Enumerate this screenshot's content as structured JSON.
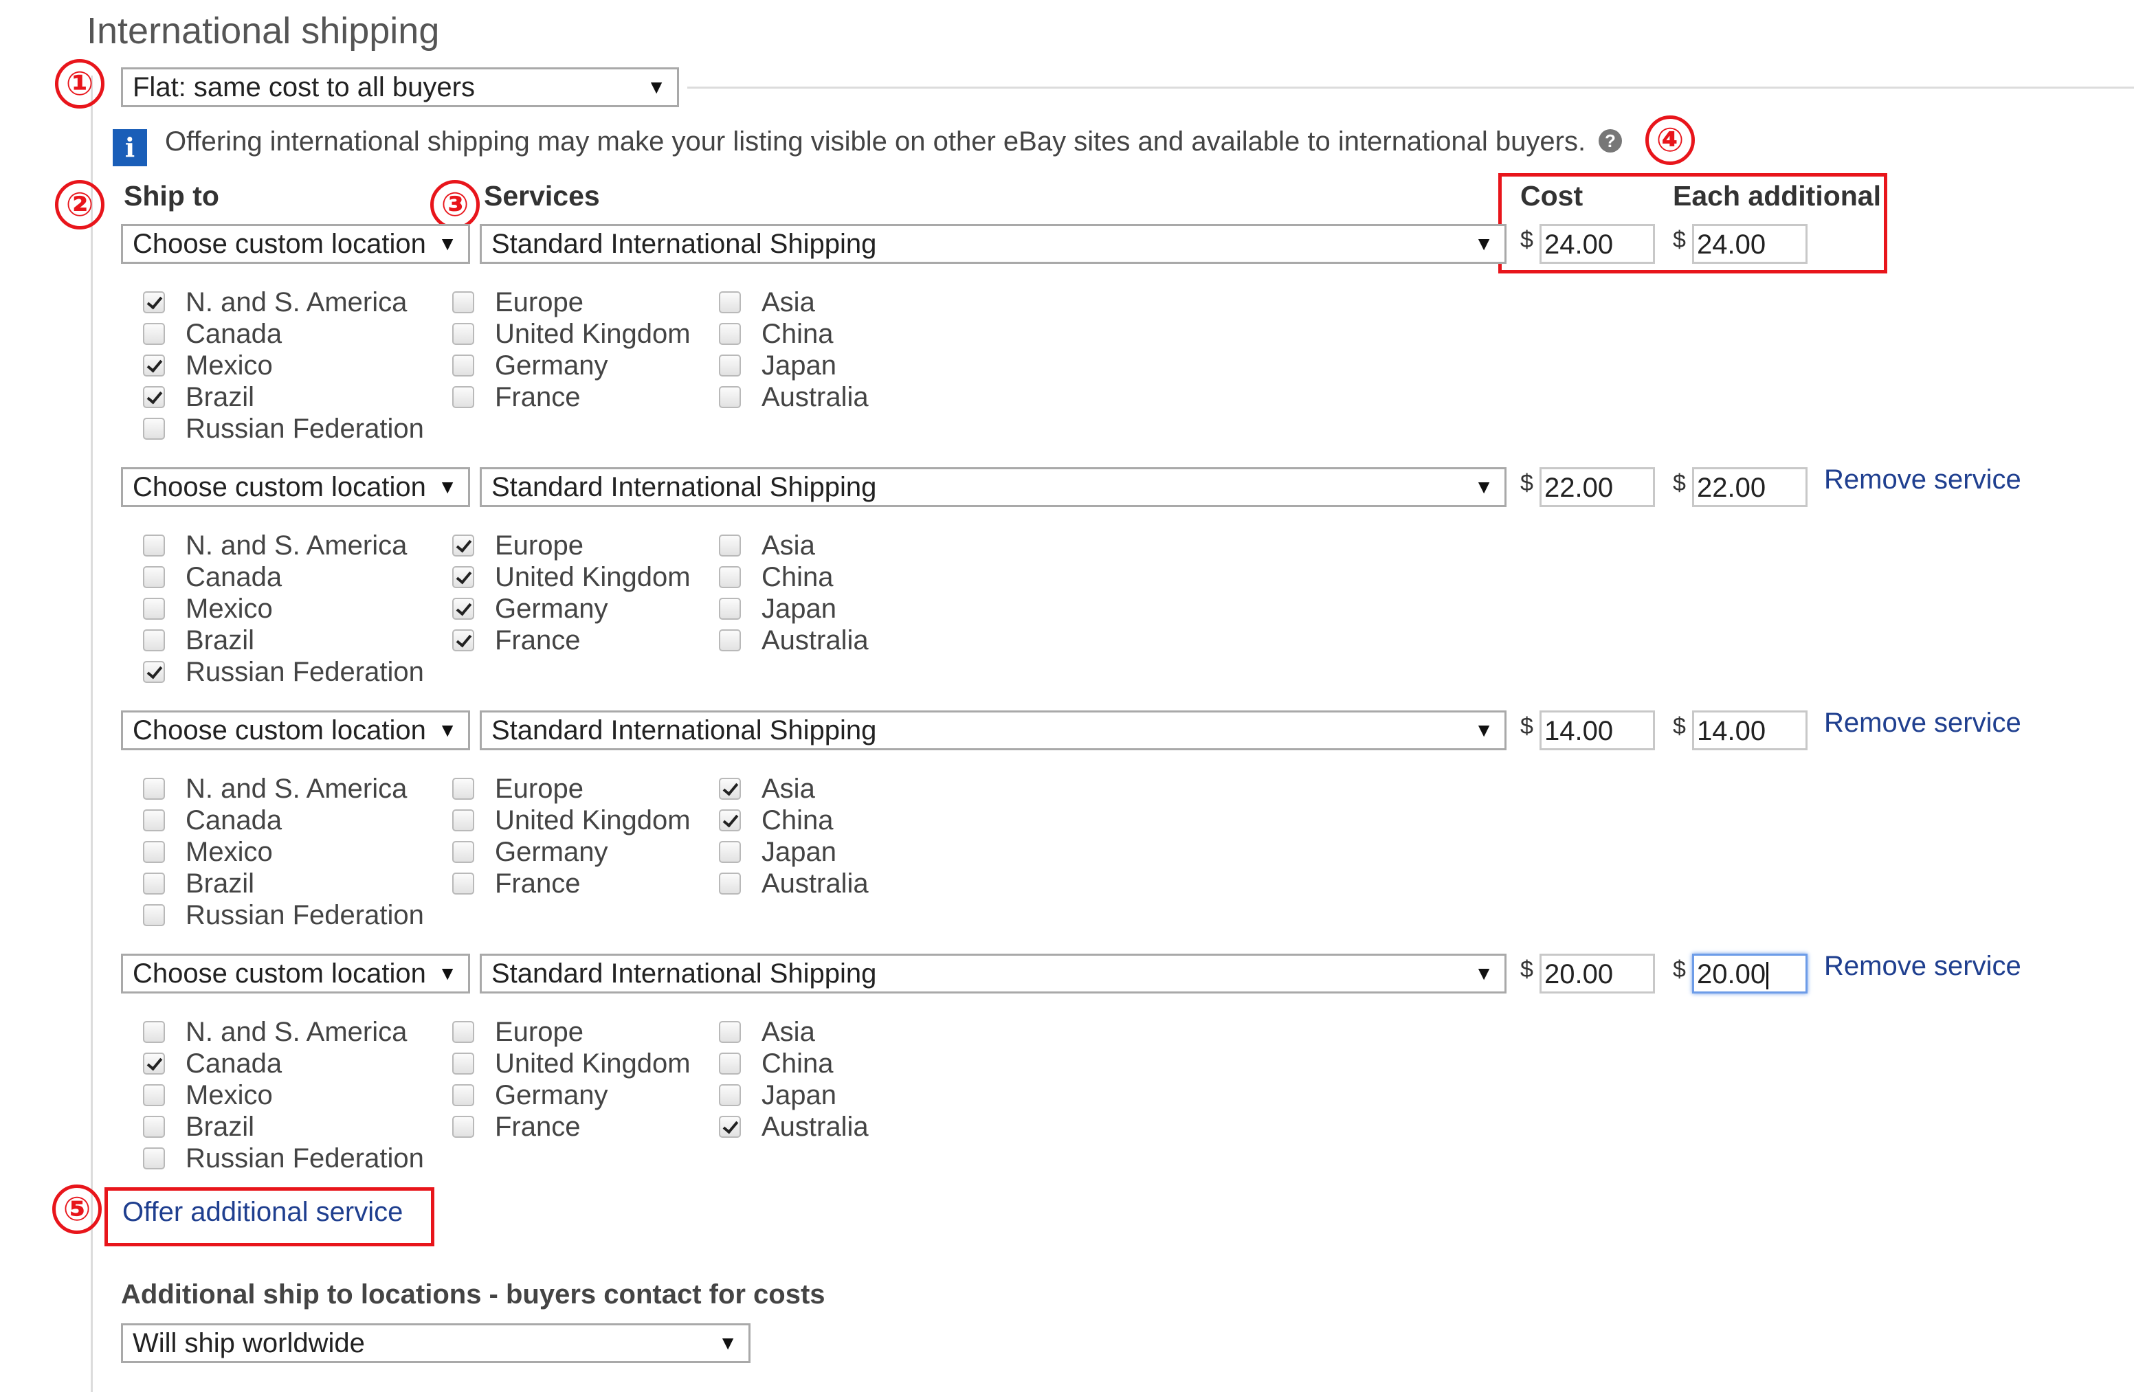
{
  "title": "International shipping",
  "shipping_type": "Flat: same cost to all buyers",
  "info_text": "Offering international shipping may make your listing visible on other eBay sites and available to international buyers.",
  "headers": {
    "ship_to": "Ship to",
    "services": "Services",
    "cost": "Cost",
    "each_additional": "Each additional"
  },
  "badges": [
    "①",
    "②",
    "③",
    "④",
    "⑤"
  ],
  "currency_symbol": "$",
  "services": [
    {
      "ship_to": "Choose custom location",
      "service": "Standard International Shipping",
      "cost": "24.00",
      "each_additional": "24.00",
      "remove_label": "",
      "locations": [
        {
          "label": "N. and S. America",
          "checked": true
        },
        {
          "label": "Canada",
          "checked": false
        },
        {
          "label": "Mexico",
          "checked": true
        },
        {
          "label": "Brazil",
          "checked": true
        },
        {
          "label": "Russian Federation",
          "checked": false
        },
        {
          "label": "Europe",
          "checked": false
        },
        {
          "label": "United Kingdom",
          "checked": false
        },
        {
          "label": "Germany",
          "checked": false
        },
        {
          "label": "France",
          "checked": false
        },
        {
          "label": "Asia",
          "checked": false
        },
        {
          "label": "China",
          "checked": false
        },
        {
          "label": "Japan",
          "checked": false
        },
        {
          "label": "Australia",
          "checked": false
        }
      ]
    },
    {
      "ship_to": "Choose custom location",
      "service": "Standard International Shipping",
      "cost": "22.00",
      "each_additional": "22.00",
      "remove_label": "Remove service",
      "locations": [
        {
          "label": "N. and S. America",
          "checked": false
        },
        {
          "label": "Canada",
          "checked": false
        },
        {
          "label": "Mexico",
          "checked": false
        },
        {
          "label": "Brazil",
          "checked": false
        },
        {
          "label": "Russian Federation",
          "checked": true
        },
        {
          "label": "Europe",
          "checked": true
        },
        {
          "label": "United Kingdom",
          "checked": true
        },
        {
          "label": "Germany",
          "checked": true
        },
        {
          "label": "France",
          "checked": true
        },
        {
          "label": "Asia",
          "checked": false
        },
        {
          "label": "China",
          "checked": false
        },
        {
          "label": "Japan",
          "checked": false
        },
        {
          "label": "Australia",
          "checked": false
        }
      ]
    },
    {
      "ship_to": "Choose custom location",
      "service": "Standard International Shipping",
      "cost": "14.00",
      "each_additional": "14.00",
      "remove_label": "Remove service",
      "locations": [
        {
          "label": "N. and S. America",
          "checked": false
        },
        {
          "label": "Canada",
          "checked": false
        },
        {
          "label": "Mexico",
          "checked": false
        },
        {
          "label": "Brazil",
          "checked": false
        },
        {
          "label": "Russian Federation",
          "checked": false
        },
        {
          "label": "Europe",
          "checked": false
        },
        {
          "label": "United Kingdom",
          "checked": false
        },
        {
          "label": "Germany",
          "checked": false
        },
        {
          "label": "France",
          "checked": false
        },
        {
          "label": "Asia",
          "checked": true
        },
        {
          "label": "China",
          "checked": true
        },
        {
          "label": "Japan",
          "checked": false
        },
        {
          "label": "Australia",
          "checked": false
        }
      ]
    },
    {
      "ship_to": "Choose custom location",
      "service": "Standard International Shipping",
      "cost": "20.00",
      "each_additional": "20.00",
      "remove_label": "Remove service",
      "locations": [
        {
          "label": "N. and S. America",
          "checked": false
        },
        {
          "label": "Canada",
          "checked": true
        },
        {
          "label": "Mexico",
          "checked": false
        },
        {
          "label": "Brazil",
          "checked": false
        },
        {
          "label": "Russian Federation",
          "checked": false
        },
        {
          "label": "Europe",
          "checked": false
        },
        {
          "label": "United Kingdom",
          "checked": false
        },
        {
          "label": "Germany",
          "checked": false
        },
        {
          "label": "France",
          "checked": false
        },
        {
          "label": "Asia",
          "checked": false
        },
        {
          "label": "China",
          "checked": false
        },
        {
          "label": "Japan",
          "checked": false
        },
        {
          "label": "Australia",
          "checked": true
        }
      ]
    }
  ],
  "offer_additional": "Offer additional service",
  "additional_locations": {
    "title": "Additional ship to locations - buyers contact for costs",
    "selected": "Will ship worldwide"
  },
  "colors": {
    "annotation": "#e8151b",
    "link": "#1f3f8f",
    "info_icon": "#1a5eb8",
    "focus": "#6d9ce8"
  }
}
